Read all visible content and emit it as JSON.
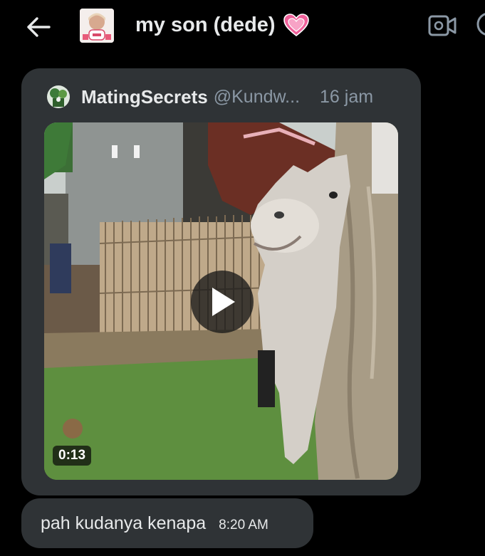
{
  "header": {
    "back_icon": "arrow-left-icon",
    "avatar_icon": "profile-avatar",
    "title": "my son (dede)",
    "title_emoji": "pink-heart-icon",
    "video_call_icon": "video-camera-icon",
    "info_icon": "info-icon"
  },
  "shared_post": {
    "author_name": "MatingSecrets",
    "author_handle": "@Kundw...",
    "time": "16 jam",
    "media": {
      "type": "video",
      "duration": "0:13",
      "play_icon": "play-icon"
    }
  },
  "message": {
    "text": "pah kudanya kenapa",
    "time": "8:20 AM"
  },
  "colors": {
    "background": "#000000",
    "bubble": "#2f3336",
    "text_primary": "#e7e9ea",
    "text_secondary": "#8b98a5",
    "heart": "#f0609a"
  }
}
